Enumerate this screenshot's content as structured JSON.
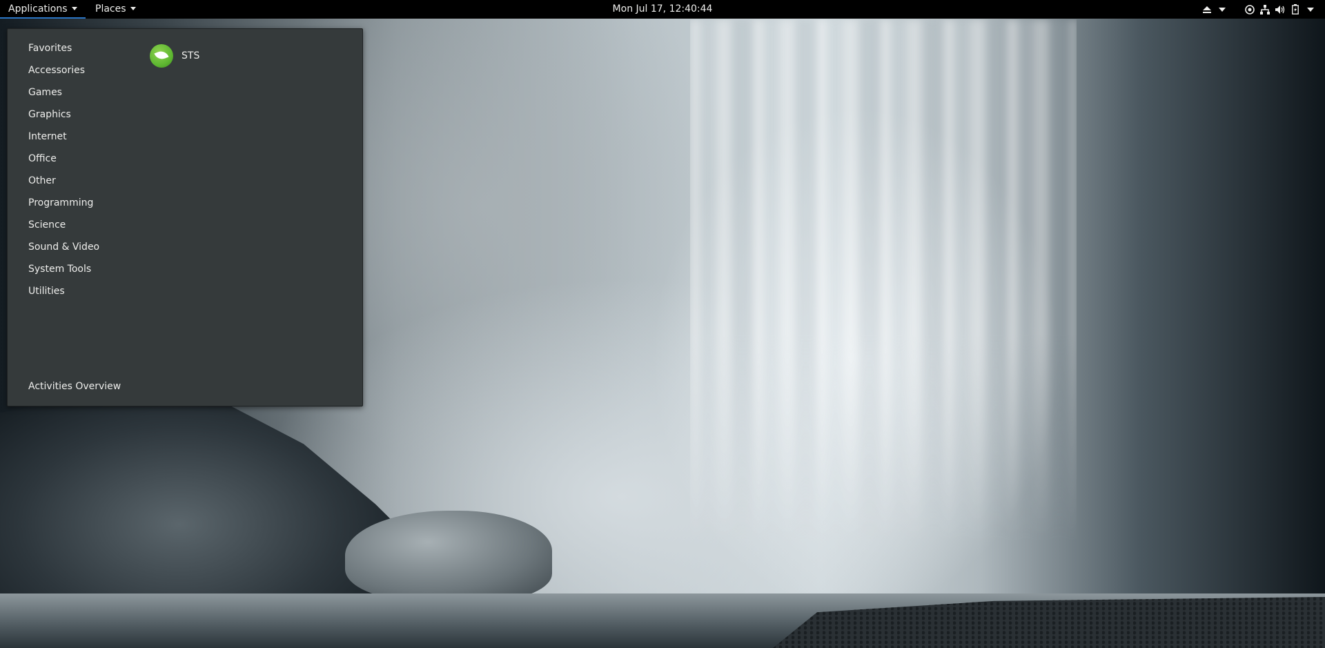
{
  "topbar": {
    "applications_label": "Applications",
    "places_label": "Places",
    "clock": "Mon Jul 17, 12:40:44"
  },
  "tray_icons": [
    "eject-icon",
    "dropdown-arrow-icon",
    "accessibility-icon",
    "network-icon",
    "volume-icon",
    "battery-icon",
    "system-menu-arrow-icon"
  ],
  "menu": {
    "categories": [
      {
        "label": "Favorites"
      },
      {
        "label": "Accessories"
      },
      {
        "label": "Games"
      },
      {
        "label": "Graphics"
      },
      {
        "label": "Internet"
      },
      {
        "label": "Office"
      },
      {
        "label": "Other"
      },
      {
        "label": "Programming"
      },
      {
        "label": "Science"
      },
      {
        "label": "Sound & Video"
      },
      {
        "label": "System Tools"
      },
      {
        "label": "Utilities"
      }
    ],
    "overview_label": "Activities Overview",
    "apps": [
      {
        "label": "STS",
        "icon": "spring-leaf-icon"
      }
    ]
  }
}
